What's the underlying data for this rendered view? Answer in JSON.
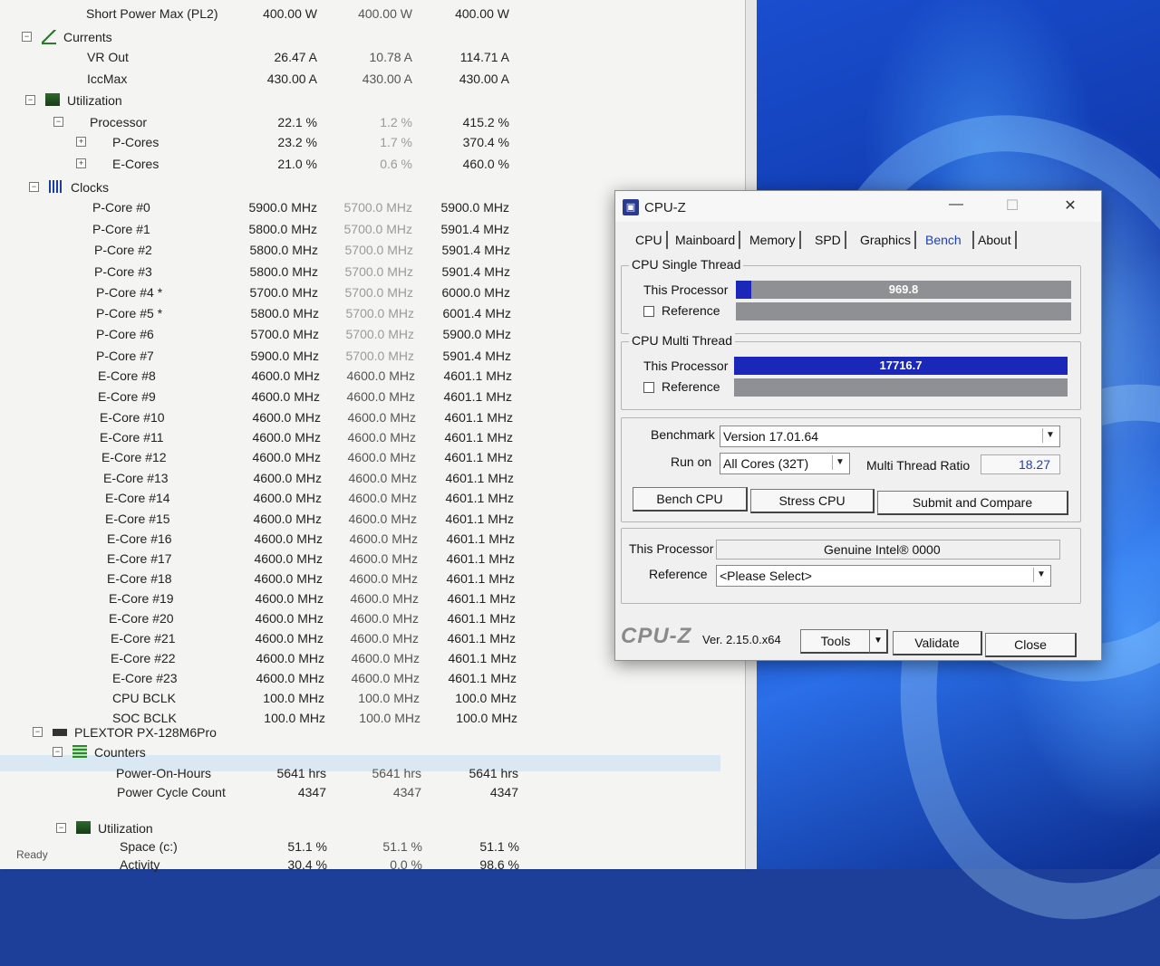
{
  "sensors": {
    "rows": [
      {
        "name": "Short Power Max (PL2)",
        "v1": "400.00 W",
        "v2": "400.00 W",
        "v3": "400.00 W"
      },
      {
        "name": "Currents",
        "group": true
      },
      {
        "name": "VR Out",
        "v1": "26.47 A",
        "v2": "10.78 A",
        "v3": "114.71 A"
      },
      {
        "name": "IccMax",
        "v1": "430.00 A",
        "v2": "430.00 A",
        "v3": "430.00 A"
      },
      {
        "name": "Utilization",
        "group": true
      },
      {
        "name": "Processor",
        "v1": "22.1 %",
        "v2": "1.2 %",
        "v3": "415.2 %"
      },
      {
        "name": "P-Cores",
        "v1": "23.2 %",
        "v2": "1.7 %",
        "v3": "370.4 %"
      },
      {
        "name": "E-Cores",
        "v1": "21.0 %",
        "v2": "0.6 %",
        "v3": "460.0 %"
      },
      {
        "name": "Clocks",
        "group": true
      },
      {
        "name": "P-Core #0",
        "v1": "5900.0 MHz",
        "v2": "5700.0 MHz",
        "v3": "5900.0 MHz"
      },
      {
        "name": "P-Core #1",
        "v1": "5800.0 MHz",
        "v2": "5700.0 MHz",
        "v3": "5901.4 MHz"
      },
      {
        "name": "P-Core #2",
        "v1": "5800.0 MHz",
        "v2": "5700.0 MHz",
        "v3": "5901.4 MHz"
      },
      {
        "name": "P-Core #3",
        "v1": "5800.0 MHz",
        "v2": "5700.0 MHz",
        "v3": "5901.4 MHz"
      },
      {
        "name": "P-Core #4 *",
        "v1": "5700.0 MHz",
        "v2": "5700.0 MHz",
        "v3": "6000.0 MHz"
      },
      {
        "name": "P-Core #5 *",
        "v1": "5800.0 MHz",
        "v2": "5700.0 MHz",
        "v3": "6001.4 MHz"
      },
      {
        "name": "P-Core #6",
        "v1": "5700.0 MHz",
        "v2": "5700.0 MHz",
        "v3": "5900.0 MHz"
      },
      {
        "name": "P-Core #7",
        "v1": "5900.0 MHz",
        "v2": "5700.0 MHz",
        "v3": "5901.4 MHz"
      },
      {
        "name": "E-Core #8",
        "v1": "4600.0 MHz",
        "v2": "4600.0 MHz",
        "v3": "4601.1 MHz"
      },
      {
        "name": "E-Core #9",
        "v1": "4600.0 MHz",
        "v2": "4600.0 MHz",
        "v3": "4601.1 MHz"
      },
      {
        "name": "E-Core #10",
        "v1": "4600.0 MHz",
        "v2": "4600.0 MHz",
        "v3": "4601.1 MHz"
      },
      {
        "name": "E-Core #11",
        "v1": "4600.0 MHz",
        "v2": "4600.0 MHz",
        "v3": "4601.1 MHz"
      },
      {
        "name": "E-Core #12",
        "v1": "4600.0 MHz",
        "v2": "4600.0 MHz",
        "v3": "4601.1 MHz"
      },
      {
        "name": "E-Core #13",
        "v1": "4600.0 MHz",
        "v2": "4600.0 MHz",
        "v3": "4601.1 MHz"
      },
      {
        "name": "E-Core #14",
        "v1": "4600.0 MHz",
        "v2": "4600.0 MHz",
        "v3": "4601.1 MHz"
      },
      {
        "name": "E-Core #15",
        "v1": "4600.0 MHz",
        "v2": "4600.0 MHz",
        "v3": "4601.1 MHz"
      },
      {
        "name": "E-Core #16",
        "v1": "4600.0 MHz",
        "v2": "4600.0 MHz",
        "v3": "4601.1 MHz"
      },
      {
        "name": "E-Core #17",
        "v1": "4600.0 MHz",
        "v2": "4600.0 MHz",
        "v3": "4601.1 MHz"
      },
      {
        "name": "E-Core #18",
        "v1": "4600.0 MHz",
        "v2": "4600.0 MHz",
        "v3": "4601.1 MHz"
      },
      {
        "name": "E-Core #19",
        "v1": "4600.0 MHz",
        "v2": "4600.0 MHz",
        "v3": "4601.1 MHz"
      },
      {
        "name": "E-Core #20",
        "v1": "4600.0 MHz",
        "v2": "4600.0 MHz",
        "v3": "4601.1 MHz"
      },
      {
        "name": "E-Core #21",
        "v1": "4600.0 MHz",
        "v2": "4600.0 MHz",
        "v3": "4601.1 MHz"
      },
      {
        "name": "E-Core #22",
        "v1": "4600.0 MHz",
        "v2": "4600.0 MHz",
        "v3": "4601.1 MHz"
      },
      {
        "name": "E-Core #23",
        "v1": "4600.0 MHz",
        "v2": "4600.0 MHz",
        "v3": "4601.1 MHz"
      },
      {
        "name": "CPU BCLK",
        "v1": "100.0 MHz",
        "v2": "100.0 MHz",
        "v3": "100.0 MHz"
      },
      {
        "name": "SOC BCLK",
        "v1": "100.0 MHz",
        "v2": "100.0 MHz",
        "v3": "100.0 MHz"
      },
      {
        "name": "PLEXTOR PX-128M6Pro",
        "group": true
      },
      {
        "name": "Counters",
        "group": true
      },
      {
        "name": "Power-On-Hours",
        "v1": "5641 hrs",
        "v2": "5641 hrs",
        "v3": "5641 hrs"
      },
      {
        "name": "Power Cycle Count",
        "v1": "4347",
        "v2": "4347",
        "v3": "4347"
      },
      {
        "name": "Utilization",
        "group": true
      },
      {
        "name": "Space (c:)",
        "v1": "51.1 %",
        "v2": "51.1 %",
        "v3": "51.1 %"
      },
      {
        "name": "Activity",
        "v1": "30.4 %",
        "v2": "0.0 %",
        "v3": "98.6 %"
      }
    ],
    "status": "Ready"
  },
  "cpuz": {
    "title": "CPU-Z",
    "window_controls": {
      "minimize": "—",
      "maximize": "☐",
      "close": "✕"
    },
    "tabs": [
      "CPU",
      "Mainboard",
      "Memory",
      "SPD",
      "Graphics",
      "Bench",
      "About"
    ],
    "active_tab": "Bench",
    "single_thread": {
      "label": "CPU Single Thread",
      "this_label": "This Processor",
      "this_value": "969.8",
      "this_fill_fraction": 0.045,
      "ref_label": "Reference"
    },
    "multi_thread": {
      "label": "CPU Multi Thread",
      "this_label": "This Processor",
      "this_value": "17716.7",
      "this_fill_fraction": 1.0,
      "ref_label": "Reference"
    },
    "benchmark_label": "Benchmark",
    "benchmark_value": "Version 17.01.64",
    "runon_label": "Run on",
    "runon_value": "All Cores (32T)",
    "ratio_label": "Multi Thread Ratio",
    "ratio_value": "18.27",
    "bench_btn": "Bench CPU",
    "stress_btn": "Stress CPU",
    "submit_btn": "Submit and Compare",
    "this_proc_label": "This Processor",
    "this_proc_value": "Genuine Intel® 0000",
    "reference_label": "Reference",
    "reference_value": "<Please Select>",
    "logo": "CPU-Z",
    "version": "Ver. 2.15.0.x64",
    "tools_btn": "Tools",
    "validate_btn": "Validate",
    "close_btn": "Close",
    "colors": {
      "bar_fill": "#1a27b8",
      "bar_bg": "#8f9094",
      "active_tab": "#1a3fbf"
    }
  }
}
